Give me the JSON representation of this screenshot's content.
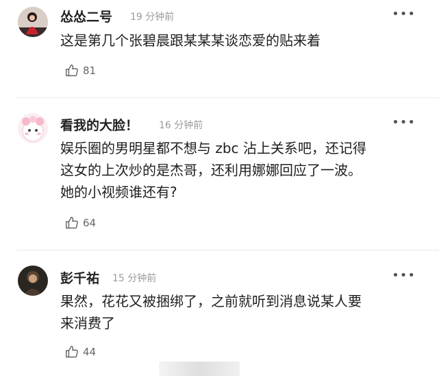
{
  "comments": [
    {
      "user": "怂怂二号",
      "time": "19 分钟前",
      "text_lines": [
        "这是第几个张碧晨跟某某某谈恋爱的贴来着"
      ],
      "likes": "81",
      "avatar_icon": "user-avatar-icon"
    },
    {
      "user": "看我的大脸！",
      "time": "16 分钟前",
      "text_lines": [
        "娱乐圈的男明星都不想与 zbc 沾上关系吧，还记得",
        "这女的上次炒的是杰哥，还利用娜娜回应了一波。",
        "她的小视频谁还有?"
      ],
      "likes": "64",
      "avatar_icon": "user-avatar-icon"
    },
    {
      "user": "彭千祐",
      "time": "15 分钟前",
      "text_lines": [
        "果然，花花又被捆绑了，之前就听到消息说某人要",
        "来消费了"
      ],
      "likes": "44",
      "avatar_icon": "user-avatar-icon"
    }
  ],
  "more_symbol": "•••",
  "like_icon": "thumbs-up-icon",
  "colors": {
    "text": "#1f1f1f",
    "muted": "#9a9a9a",
    "divider": "#e8e8e8"
  }
}
